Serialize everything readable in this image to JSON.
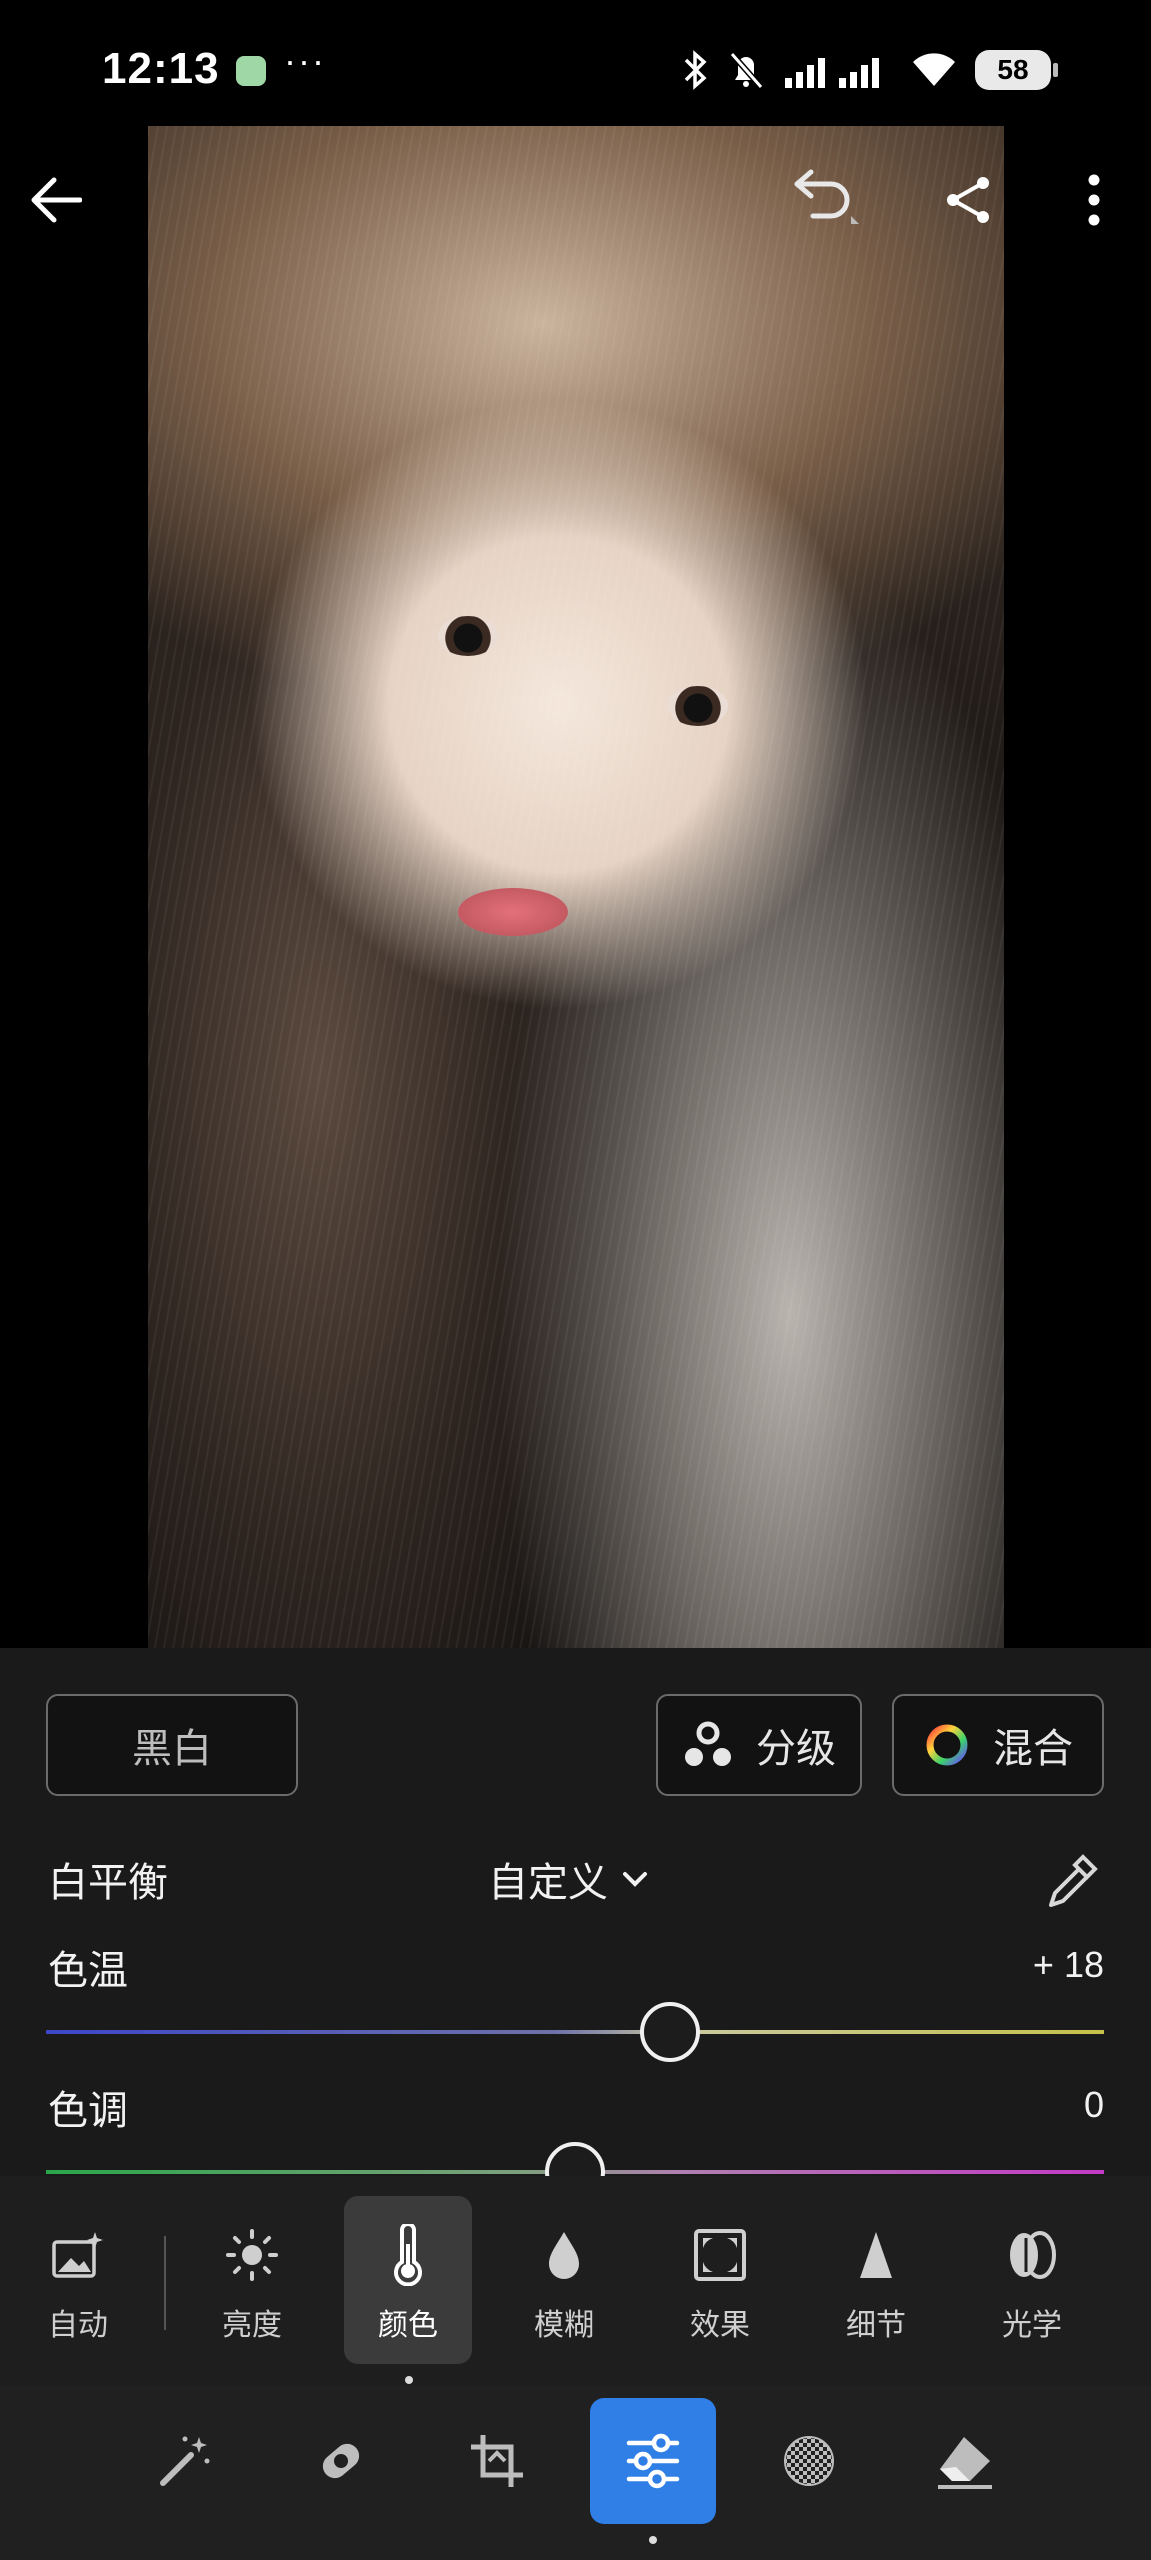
{
  "status_bar": {
    "time": "12:13",
    "more": "···",
    "battery": "58"
  },
  "color_panel": {
    "bw_button": "黑白",
    "grading_button": "分级",
    "mixer_button": "混合",
    "white_balance_label": "白平衡",
    "white_balance_value": "自定义",
    "temperature_label": "色温",
    "temperature_value": "+ 18",
    "temperature_level": 18,
    "tint_label": "色调",
    "tint_value": "0",
    "tint_level": 0
  },
  "tool_tabs": [
    {
      "label": "自动",
      "icon": "auto-icon"
    },
    {
      "label": "亮度",
      "icon": "brightness-icon"
    },
    {
      "label": "颜色",
      "icon": "thermometer-icon",
      "active": true
    },
    {
      "label": "模糊",
      "icon": "blur-drop-icon"
    },
    {
      "label": "效果",
      "icon": "effects-icon"
    },
    {
      "label": "细节",
      "icon": "detail-icon"
    },
    {
      "label": "光学",
      "icon": "optics-icon"
    }
  ],
  "bottom_nav": [
    {
      "icon": "magic-wand-icon"
    },
    {
      "icon": "healing-icon"
    },
    {
      "icon": "crop-icon"
    },
    {
      "icon": "adjust-sliders-icon",
      "active": true
    },
    {
      "icon": "mask-icon"
    },
    {
      "icon": "eraser-icon"
    }
  ],
  "colors": {
    "accent": "#2f7fe6",
    "panel_bg": "#1c1c1c"
  }
}
